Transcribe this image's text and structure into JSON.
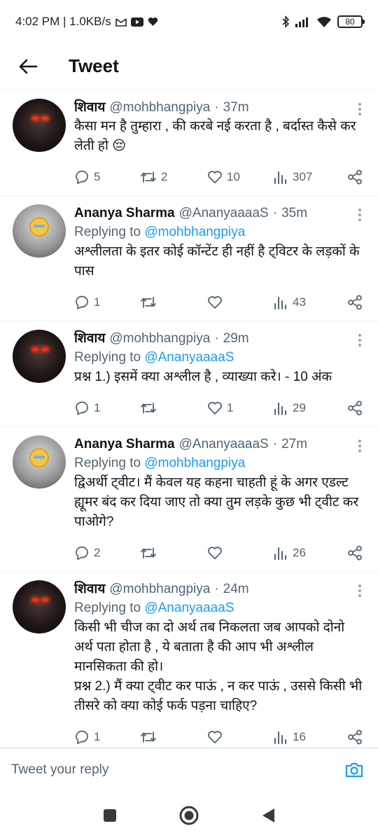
{
  "status": {
    "time_speed": "4:02 PM | 1.0KB/s",
    "battery": "80",
    "icons": [
      "gmail-icon",
      "youtube-icon",
      "heart-icon",
      "bluetooth-icon",
      "signal-icon",
      "wifi-icon",
      "battery-icon"
    ]
  },
  "header": {
    "title": "Tweet",
    "back_icon": "arrow-left-icon"
  },
  "tweets": [
    {
      "name": "शिवाय",
      "handle": "@mohbhangpiya",
      "sep": "·",
      "time": "37m",
      "replying_prefix": "",
      "replying_to": "",
      "text": "कैसा मन है तुम्हारा , की करबे नई करता है , बर्दास्त कैसे कर लेती हो 😔",
      "replies": "5",
      "retweets": "2",
      "likes": "10",
      "views": "307"
    },
    {
      "name": "Ananya Sharma",
      "handle": "@AnanyaaaaS",
      "sep": "·",
      "time": "35m",
      "replying_prefix": "Replying to ",
      "replying_to": "@mohbhangpiya",
      "text": "अश्लीलता के इतर कोई कॉन्टेंट ही नहीं है ट्विटर के लड़कों के पास",
      "replies": "1",
      "retweets": "",
      "likes": "",
      "views": "43"
    },
    {
      "name": "शिवाय",
      "handle": "@mohbhangpiya",
      "sep": "·",
      "time": "29m",
      "replying_prefix": "Replying to ",
      "replying_to": "@AnanyaaaaS",
      "text": "प्रश्न 1.) इसमें क्या अश्लील है , व्याख्या करे। - 10 अंक",
      "replies": "1",
      "retweets": "",
      "likes": "1",
      "views": "29"
    },
    {
      "name": "Ananya Sharma",
      "handle": "@AnanyaaaaS",
      "sep": "·",
      "time": "27m",
      "replying_prefix": "Replying to ",
      "replying_to": "@mohbhangpiya",
      "text": "द्विअर्थी ट्वीट। मैं केवल यह कहना चाहती हूं के अगर एडल्ट ह्यूमर बंद कर दिया जाए तो क्या तुम लड़के कुछ भी ट्वीट कर पाओगे?",
      "replies": "2",
      "retweets": "",
      "likes": "",
      "views": "26"
    },
    {
      "name": "शिवाय",
      "handle": "@mohbhangpiya",
      "sep": "·",
      "time": "24m",
      "replying_prefix": "Replying to ",
      "replying_to": "@AnanyaaaaS",
      "text": "किसी भी चीज का दो अर्थ तब निकलता जब आपको दोनो अर्थ पता होता है , ये बताता है की आप भी अश्लील मानसिकता की हो।\nप्रश्न 2.) मैं क्या ट्वीट कर पाऊं , न कर पाऊं , उससे किसी भी तीसरे को क्या कोई फर्क पड़ना चाहिए?",
      "replies": "1",
      "retweets": "",
      "likes": "",
      "views": "16"
    }
  ],
  "compose": {
    "placeholder": "Tweet your reply",
    "camera_icon": "camera-icon"
  },
  "colors": {
    "accent": "#1d9bf0",
    "secondary_text": "#536471",
    "primary_text": "#0f1419"
  }
}
